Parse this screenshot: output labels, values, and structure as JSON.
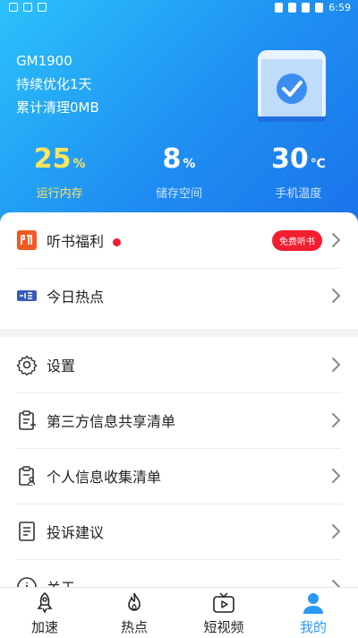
{
  "status_bar": {
    "time": "6:59"
  },
  "header": {
    "model": "GM1900",
    "optimized": "持续优化1天",
    "cleaned": "累计清理0MB",
    "stats": [
      {
        "value": "25",
        "unit": "%",
        "label": "运行内存"
      },
      {
        "value": "8",
        "unit": "%",
        "label": "储存空间"
      },
      {
        "value": "30",
        "unit": "℃",
        "label": "手机温度"
      }
    ]
  },
  "card1": {
    "items": [
      {
        "label": "听书福利",
        "badge": "免费听书",
        "icon": "headphone-book-icon"
      },
      {
        "label": "今日热点",
        "icon": "news-icon"
      }
    ]
  },
  "card2": {
    "items": [
      {
        "label": "设置",
        "icon": "gear-icon"
      },
      {
        "label": "第三方信息共享清单",
        "icon": "clipboard-share-icon"
      },
      {
        "label": "个人信息收集清单",
        "icon": "clipboard-user-icon"
      },
      {
        "label": "投诉建议",
        "icon": "document-icon"
      },
      {
        "label": "关于",
        "icon": "info-icon"
      }
    ]
  },
  "tabs": [
    {
      "label": "加速",
      "icon": "rocket-icon"
    },
    {
      "label": "热点",
      "icon": "flame-icon"
    },
    {
      "label": "短视频",
      "icon": "video-icon"
    },
    {
      "label": "我的",
      "icon": "user-icon",
      "active": true
    }
  ],
  "colors": {
    "accent": "#2a9af4",
    "badge_red": "#f21d2f",
    "highlight_yellow": "#ffe45c",
    "listen_orange": "#f05a22"
  }
}
